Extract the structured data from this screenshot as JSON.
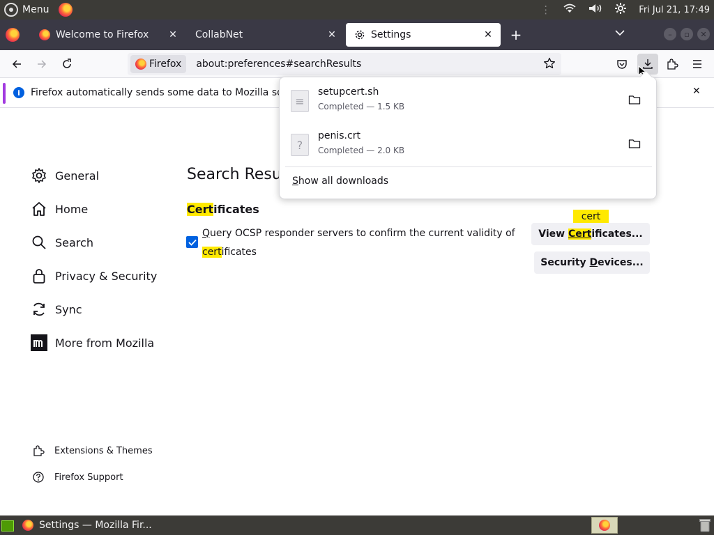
{
  "system_panel": {
    "menu_label": "Menu",
    "clock": "Fri Jul 21, 17:49",
    "icons": [
      "ubuntu-menu-icon",
      "firefox-launcher-icon",
      "network-icon",
      "volume-icon",
      "settings-icon"
    ]
  },
  "tabs": [
    {
      "label": "Welcome to Firefox",
      "icon": "firefox-icon"
    },
    {
      "label": "CollabNet",
      "icon": ""
    },
    {
      "label": "Settings",
      "icon": "gear-icon",
      "active": true
    }
  ],
  "navbar": {
    "identity_label": "Firefox",
    "url": "about:preferences#searchResults"
  },
  "notification": {
    "text": "Firefox automatically sends some data to Mozilla so th"
  },
  "sidebar": {
    "items": [
      {
        "label": "General",
        "icon": "gear-icon"
      },
      {
        "label": "Home",
        "icon": "home-icon"
      },
      {
        "label": "Search",
        "icon": "search-icon"
      },
      {
        "label": "Privacy & Security",
        "icon": "lock-icon"
      },
      {
        "label": "Sync",
        "icon": "sync-icon"
      },
      {
        "label": "More from Mozilla",
        "icon": "mozilla-icon"
      }
    ],
    "footer": [
      {
        "label": "Extensions & Themes",
        "icon": "puzzle-icon"
      },
      {
        "label": "Firefox Support",
        "icon": "help-icon"
      }
    ]
  },
  "content": {
    "title": "Search Results",
    "section": {
      "highlight": "Cert",
      "rest": "ificates"
    },
    "ocsp": {
      "line1_prefix": "Q",
      "line1": "uery OCSP responder servers to confirm the current validity of",
      "line2_highlight": "cert",
      "line2_rest": "ificates",
      "checked": true
    },
    "view_certificates": {
      "pre": "View ",
      "highlight": "Cert",
      "rest": "ificates..."
    },
    "security_devices": {
      "pre": "Security ",
      "underline": "D",
      "rest": "evices..."
    },
    "tooltip": "cert"
  },
  "downloads": {
    "items": [
      {
        "name": "setupcert.sh",
        "status": "Completed — 1.5 KB"
      },
      {
        "name": "penis.crt",
        "status": "Completed — 2.0 KB"
      }
    ],
    "show_all_underline": "S",
    "show_all_rest": "how all downloads"
  },
  "taskbar": {
    "window_title": "Settings — Mozilla Fir..."
  }
}
